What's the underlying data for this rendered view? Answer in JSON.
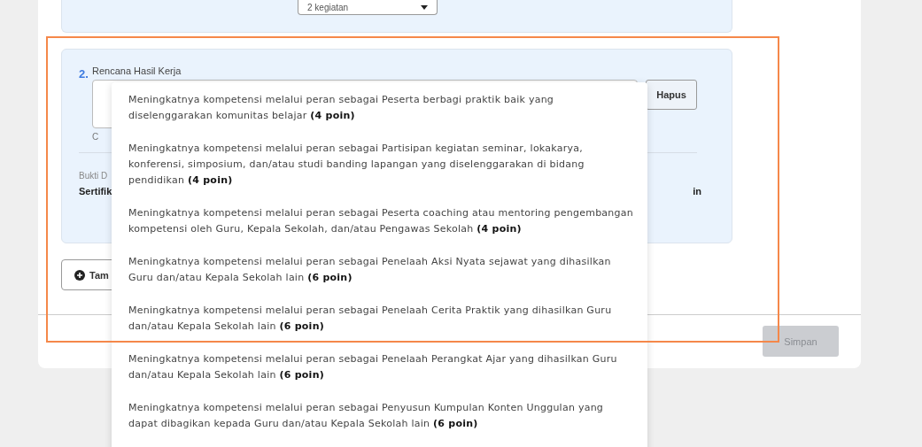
{
  "previous_activity": {
    "count_select": {
      "value": "2 kegiatan"
    }
  },
  "activity": {
    "number": "2.",
    "label": "Rencana Hasil Kerja",
    "delete_button": "Hapus",
    "helper_text": "C",
    "evidence_label": "Bukti D",
    "evidence_value": "Sertifik",
    "points_fragment": "in"
  },
  "add_button": "Tam",
  "save_button": {
    "label": "Simpan",
    "disabled": true
  },
  "dropdown": {
    "options": [
      {
        "text": "Meningkatnya kompetensi melalui peran sebagai Peserta berbagi praktik baik yang diselenggarakan komunitas belajar **(4 poin)**"
      },
      {
        "text": "Meningkatnya kompetensi melalui peran sebagai Partisipan kegiatan seminar, lokakarya, konferensi, simposium, dan/atau studi banding lapangan yang diselenggarakan di bidang pendidikan **(4 poin)**"
      },
      {
        "text": "Meningkatnya kompetensi melalui peran sebagai Peserta coaching atau mentoring pengembangan kompetensi oleh Guru, Kepala Sekolah, dan/atau Pengawas Sekolah **(4 poin)**"
      },
      {
        "text": "Meningkatnya kompetensi melalui peran sebagai Penelaah Aksi Nyata sejawat yang dihasilkan Guru dan/atau Kepala Sekolah lain **(6 poin)**"
      },
      {
        "text": "Meningkatnya kompetensi melalui peran sebagai Penelaah Cerita Praktik yang dihasilkan Guru dan/atau Kepala Sekolah lain **(6 poin)**"
      },
      {
        "text": "Meningkatnya kompetensi melalui peran sebagai Penelaah Perangkat Ajar yang dihasilkan Guru dan/atau Kepala Sekolah lain **(6 poin)**"
      },
      {
        "text": "Meningkatnya kompetensi melalui peran sebagai Penyusun Kumpulan Konten Unggulan yang dapat dibagikan kepada Guru dan/atau Kepala Sekolah lain **(6 poin)**"
      }
    ]
  }
}
